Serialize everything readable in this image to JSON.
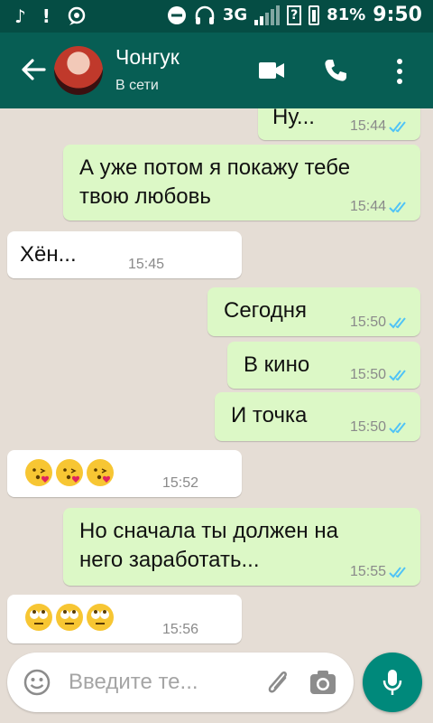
{
  "status_bar": {
    "music_glyph": "♪",
    "alert_glyph": "!",
    "network_type": "3G",
    "battery_percent": "81%",
    "time": "9:50",
    "icons": [
      "music-note-icon",
      "alert-icon",
      "notification-icon",
      "do-not-disturb-icon",
      "headset-icon",
      "signal-icon",
      "sim-unknown-icon",
      "battery-charging-icon"
    ]
  },
  "header": {
    "contact_name": "Чонгук",
    "contact_status": "В сети",
    "icons": [
      "back-arrow-icon",
      "avatar",
      "video-call-icon",
      "phone-call-icon",
      "more-options-icon"
    ]
  },
  "messages": [
    {
      "direction": "out",
      "text": "Ну...",
      "time": "15:44",
      "read": true
    },
    {
      "direction": "out",
      "text": "А уже потом я покажу тебе\nтвою любовь",
      "time": "15:44",
      "read": true
    },
    {
      "direction": "in",
      "text": "Хён...",
      "time": "15:45"
    },
    {
      "direction": "out",
      "text": "Сегодня",
      "time": "15:50",
      "read": true
    },
    {
      "direction": "out",
      "text": "В кино",
      "time": "15:50",
      "read": true
    },
    {
      "direction": "out",
      "text": "И точка",
      "time": "15:50",
      "read": true
    },
    {
      "direction": "in",
      "emoji": [
        "face-blowing-kiss",
        "face-blowing-kiss",
        "face-blowing-kiss"
      ],
      "time": "15:52"
    },
    {
      "direction": "out",
      "text": "Но сначала ты должен на\nнего заработать...",
      "time": "15:55",
      "read": true
    },
    {
      "direction": "in",
      "emoji": [
        "face-rolling-eyes",
        "face-rolling-eyes",
        "face-rolling-eyes"
      ],
      "time": "15:56"
    }
  ],
  "composer": {
    "placeholder": "Введите те...",
    "icons": [
      "emoji-icon",
      "attach-icon",
      "camera-icon",
      "mic-icon"
    ]
  },
  "colors": {
    "status_bar": "#054d44",
    "app_bar": "#075e54",
    "chat_background": "#e5ddd5",
    "outgoing_bubble": "#dcf8c6",
    "incoming_bubble": "#ffffff",
    "read_ticks": "#4fc3f7",
    "mic_button": "#00897b"
  }
}
